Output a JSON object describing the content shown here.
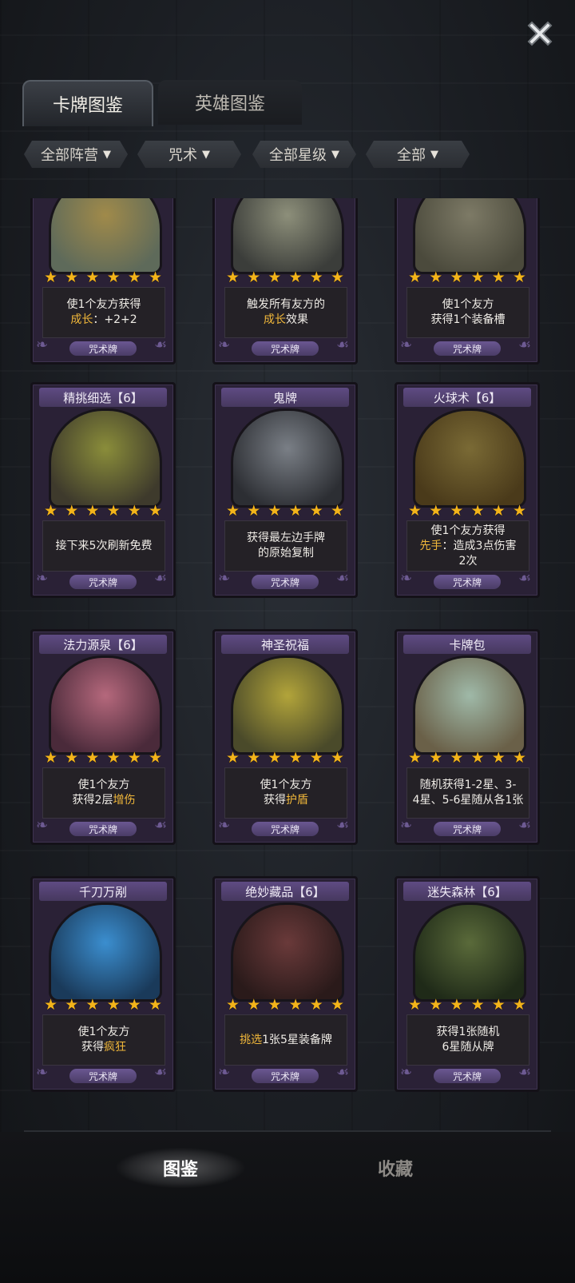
{
  "close": {
    "icon": "close-x-icon"
  },
  "tabs": [
    {
      "label": "卡牌图鉴",
      "active": true
    },
    {
      "label": "英雄图鉴",
      "active": false
    }
  ],
  "filters": [
    {
      "label": "全部阵营"
    },
    {
      "label": "咒术"
    },
    {
      "label": "全部星级"
    },
    {
      "label": "全部"
    }
  ],
  "cards": [
    {
      "name": "",
      "stars": 6,
      "desc": [
        "使1个友方获得",
        "成长：+2+2"
      ],
      "type": "咒术牌",
      "art": "gold-bag-icon"
    },
    {
      "name": "",
      "stars": 6,
      "desc": [
        "触发所有友方的",
        "成长效果"
      ],
      "type": "咒术牌",
      "art": "pocket-watch-icon"
    },
    {
      "name": "",
      "stars": 6,
      "desc": [
        "使1个友方",
        "获得1个装备槽"
      ],
      "type": "咒术牌",
      "art": "magic-pedestal-icon"
    },
    {
      "name": "精挑细选【6】",
      "stars": 6,
      "desc": [
        "接下来5次刷新免费"
      ],
      "type": "咒术牌",
      "art": "inventor-icon"
    },
    {
      "name": "鬼牌",
      "stars": 6,
      "desc": [
        "获得最左边手牌",
        "的原始复制"
      ],
      "type": "咒术牌",
      "art": "skull-joker-icon"
    },
    {
      "name": "火球术【6】",
      "stars": 6,
      "desc": [
        "使1个友方获得",
        "先手：造成3点伤害",
        "2次"
      ],
      "type": "咒术牌",
      "art": "fireball-icon"
    },
    {
      "name": "法力源泉【6】",
      "stars": 6,
      "desc": [
        "使1个友方",
        "获得2层增伤"
      ],
      "type": "咒术牌",
      "art": "mana-fountain-icon"
    },
    {
      "name": "神圣祝福",
      "stars": 6,
      "desc": [
        "使1个友方",
        "获得护盾"
      ],
      "type": "咒术牌",
      "art": "holy-light-icon"
    },
    {
      "name": "卡牌包",
      "stars": 6,
      "desc": [
        "随机获得1-2星、3-",
        "4星、5-6星随从各1张"
      ],
      "type": "咒术牌",
      "art": "card-pack-icon"
    },
    {
      "name": "千刀万剐",
      "stars": 6,
      "desc": [
        "使1个友方",
        "获得疯狂"
      ],
      "type": "咒术牌",
      "art": "blades-icon"
    },
    {
      "name": "绝妙藏品【6】",
      "stars": 6,
      "desc": [
        "挑选1张5星装备牌"
      ],
      "type": "咒术牌",
      "art": "wrapped-relic-icon"
    },
    {
      "name": "迷失森林【6】",
      "stars": 6,
      "desc": [
        "获得1张随机",
        "6星随从牌"
      ],
      "type": "咒术牌",
      "art": "lost-forest-icon"
    }
  ],
  "highlights": [
    "成长",
    "先手",
    "增伤",
    "护盾",
    "疯狂",
    "挑选"
  ],
  "bottom_nav": [
    {
      "label": "图鉴",
      "active": true
    },
    {
      "label": "收藏",
      "active": false
    }
  ],
  "colors": {
    "star": "#f3b41a",
    "highlight": "#f0b73a",
    "card_frame": "#5f4b83"
  }
}
